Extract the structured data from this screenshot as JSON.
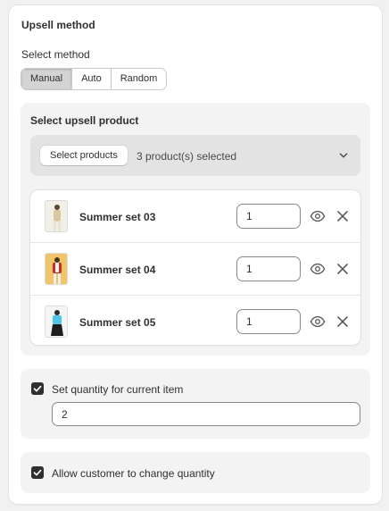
{
  "card": {
    "title": "Upsell method",
    "method_label": "Select method",
    "methods": [
      "Manual",
      "Auto",
      "Random"
    ],
    "active_method": "Manual"
  },
  "upsell": {
    "title": "Select upsell product",
    "select_button": "Select products",
    "selected_count": "3 product(s) selected",
    "products": [
      {
        "name": "Summer set 03",
        "quantity": "1",
        "thumb_colors": [
          "#f2efe6",
          "#d8c9a4"
        ]
      },
      {
        "name": "Summer set 04",
        "quantity": "1",
        "thumb_colors": [
          "#f0c56a",
          "#c0312e"
        ]
      },
      {
        "name": "Summer set 05",
        "quantity": "1",
        "thumb_colors": [
          "#4ec7e6",
          "#1d1d1d"
        ]
      }
    ]
  },
  "quantity_settings": {
    "set_quantity_label": "Set quantity for current item",
    "set_quantity_checked": true,
    "quantity_value": "2",
    "allow_change_label": "Allow customer to change quantity",
    "allow_change_checked": true
  }
}
